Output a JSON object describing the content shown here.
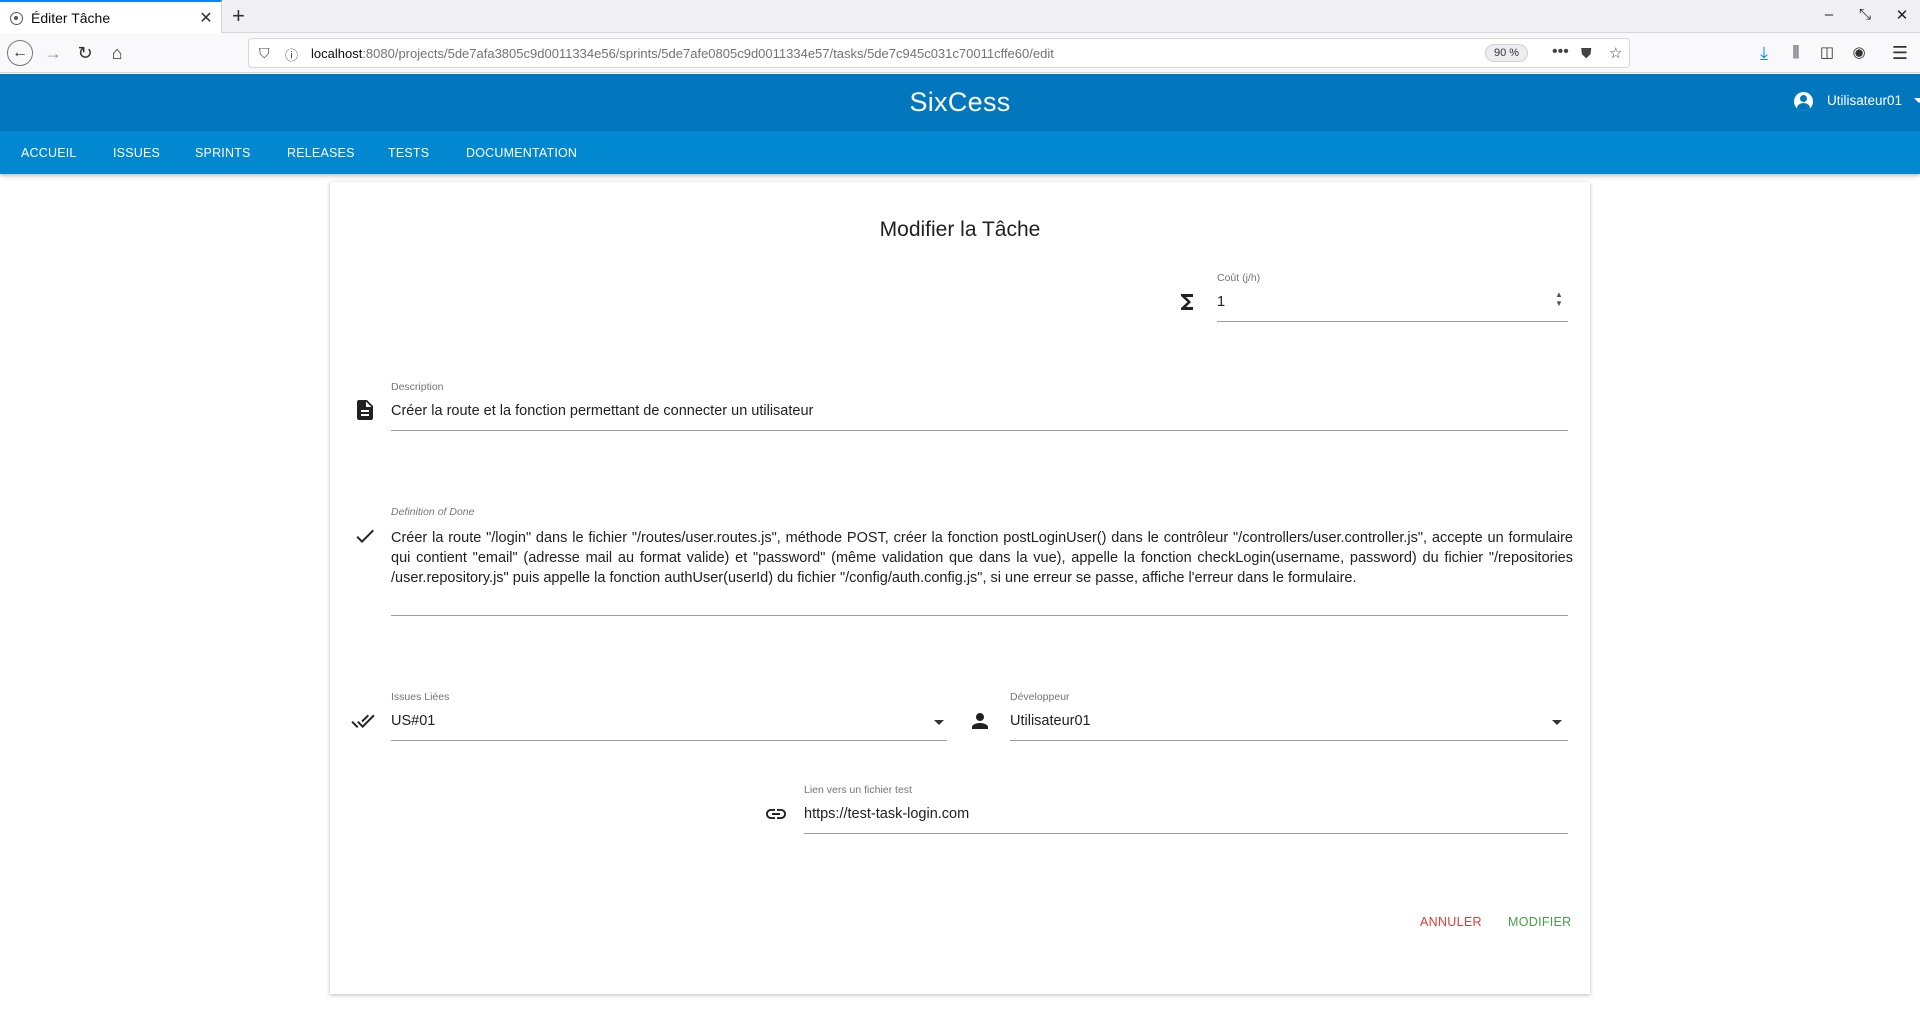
{
  "browser": {
    "tab_title": "Éditer Tâche",
    "url_host": "localhost",
    "url_rest": ":8080/projects/5de7afa3805c9d0011334e56/sprints/5de7afe0805c9d0011334e57/tasks/5de7c945c031c70011cffe60/edit",
    "zoom": "90 %"
  },
  "app": {
    "title": "SixCess",
    "user_name": "Utilisateur01",
    "nav_tabs": [
      "ACCUEIL",
      "ISSUES",
      "SPRINTS",
      "RELEASES",
      "TESTS",
      "DOCUMENTATION"
    ]
  },
  "form": {
    "title": "Modifier la Tâche",
    "cost_label": "Coût (j/h)",
    "cost_value": "1",
    "description_label": "Description",
    "description_value": "Créer la route et la fonction permettant de connecter un utilisateur",
    "dod_label": "Definition of Done",
    "dod_value": "Créer la route \"/login\" dans le fichier \"/routes/user.routes.js\", méthode POST, créer la fonction postLoginUser() dans le contrôleur \"/controllers/user.controller.js\", accepte un formulaire qui contient \"email\" (adresse mail au format valide) et \"password\" (même validation que dans la vue), appelle la fonction checkLogin(username, password) du fichier \"/repositories /user.repository.js\" puis appelle la fonction authUser(userId) du fichier \"/config/auth.config.js\", si une erreur se passe, affiche l'erreur dans le formulaire.",
    "issues_label": "Issues Liées",
    "issues_value": "US#01",
    "dev_label": "Développeur",
    "dev_value": "Utilisateur01",
    "test_label": "Lien vers un fichier test",
    "test_value": "https://test-task-login.com",
    "cancel_label": "ANNULER",
    "submit_label": "MODIFIER"
  },
  "colors": {
    "header": "#0277bd",
    "nav": "#0288d1",
    "cancel": "#e53935",
    "submit": "#43a047"
  }
}
